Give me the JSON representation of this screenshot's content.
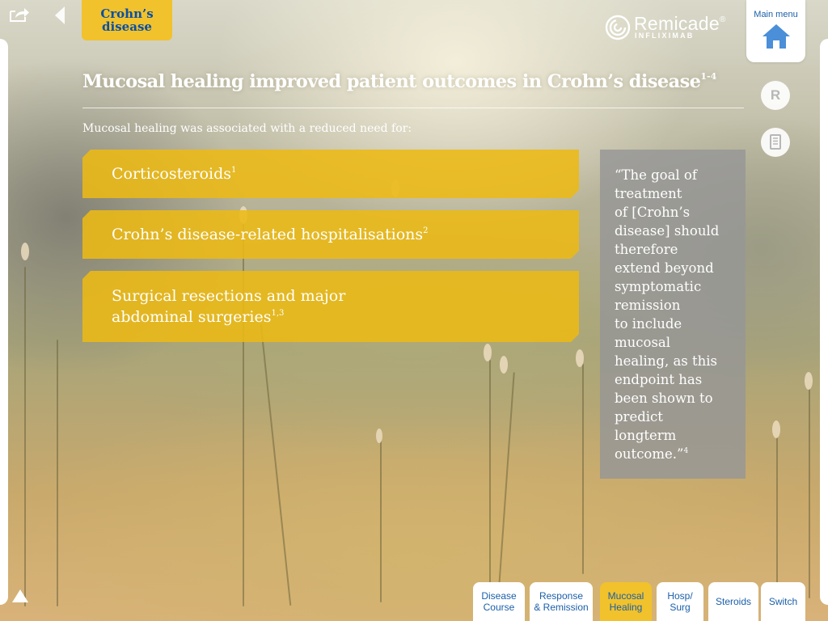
{
  "header": {
    "section_tag": [
      "Crohn’s",
      "disease"
    ],
    "logo": {
      "name": "Remicade",
      "trademark": "®",
      "sub": "INFLIXIMAB"
    },
    "main_menu_label": "Main menu",
    "side_buttons": {
      "references_label": "R"
    }
  },
  "page": {
    "title": "Mucosal healing improved patient outcomes in Crohn’s disease",
    "title_refs": "1-4",
    "intro": "Mucosal healing was associated with a reduced need for:"
  },
  "outcomes": [
    {
      "lines": [
        "Corticosteroids"
      ],
      "refs": "1"
    },
    {
      "lines": [
        "Crohn’s disease-related hospitalisations"
      ],
      "refs": "2"
    },
    {
      "lines": [
        "Surgical resections and major",
        "abdominal surgeries"
      ],
      "refs": "1,3"
    }
  ],
  "quote": {
    "lines": [
      "“The goal of",
      "treatment",
      "of [Crohn’s",
      "disease] should",
      "therefore",
      "extend beyond",
      "symptomatic",
      "remission",
      "to include",
      "mucosal",
      "healing, as this",
      "endpoint has",
      "been shown to",
      "predict",
      "longterm",
      "outcome.”"
    ],
    "ref": "4"
  },
  "tabs": [
    {
      "lines": [
        "Disease",
        "Course"
      ],
      "active": false
    },
    {
      "lines": [
        "Response",
        "& Remission"
      ],
      "active": false
    },
    {
      "lines": [
        "Mucosal",
        "Healing"
      ],
      "active": true
    },
    {
      "lines": [
        "Hosp/",
        "Surg"
      ],
      "active": false
    },
    {
      "lines": [
        "Steroids"
      ],
      "active": false
    },
    {
      "lines": [
        "Switch"
      ],
      "active": false
    }
  ],
  "theme": {
    "accent_yellow": "#f1c22c",
    "link_blue": "#1b5faa",
    "quote_gray": "#969696"
  },
  "icons": [
    "share-icon",
    "back-arrow-icon",
    "home-icon",
    "references-icon",
    "document-icon",
    "up-arrow-icon",
    "remicade-logo-icon"
  ]
}
